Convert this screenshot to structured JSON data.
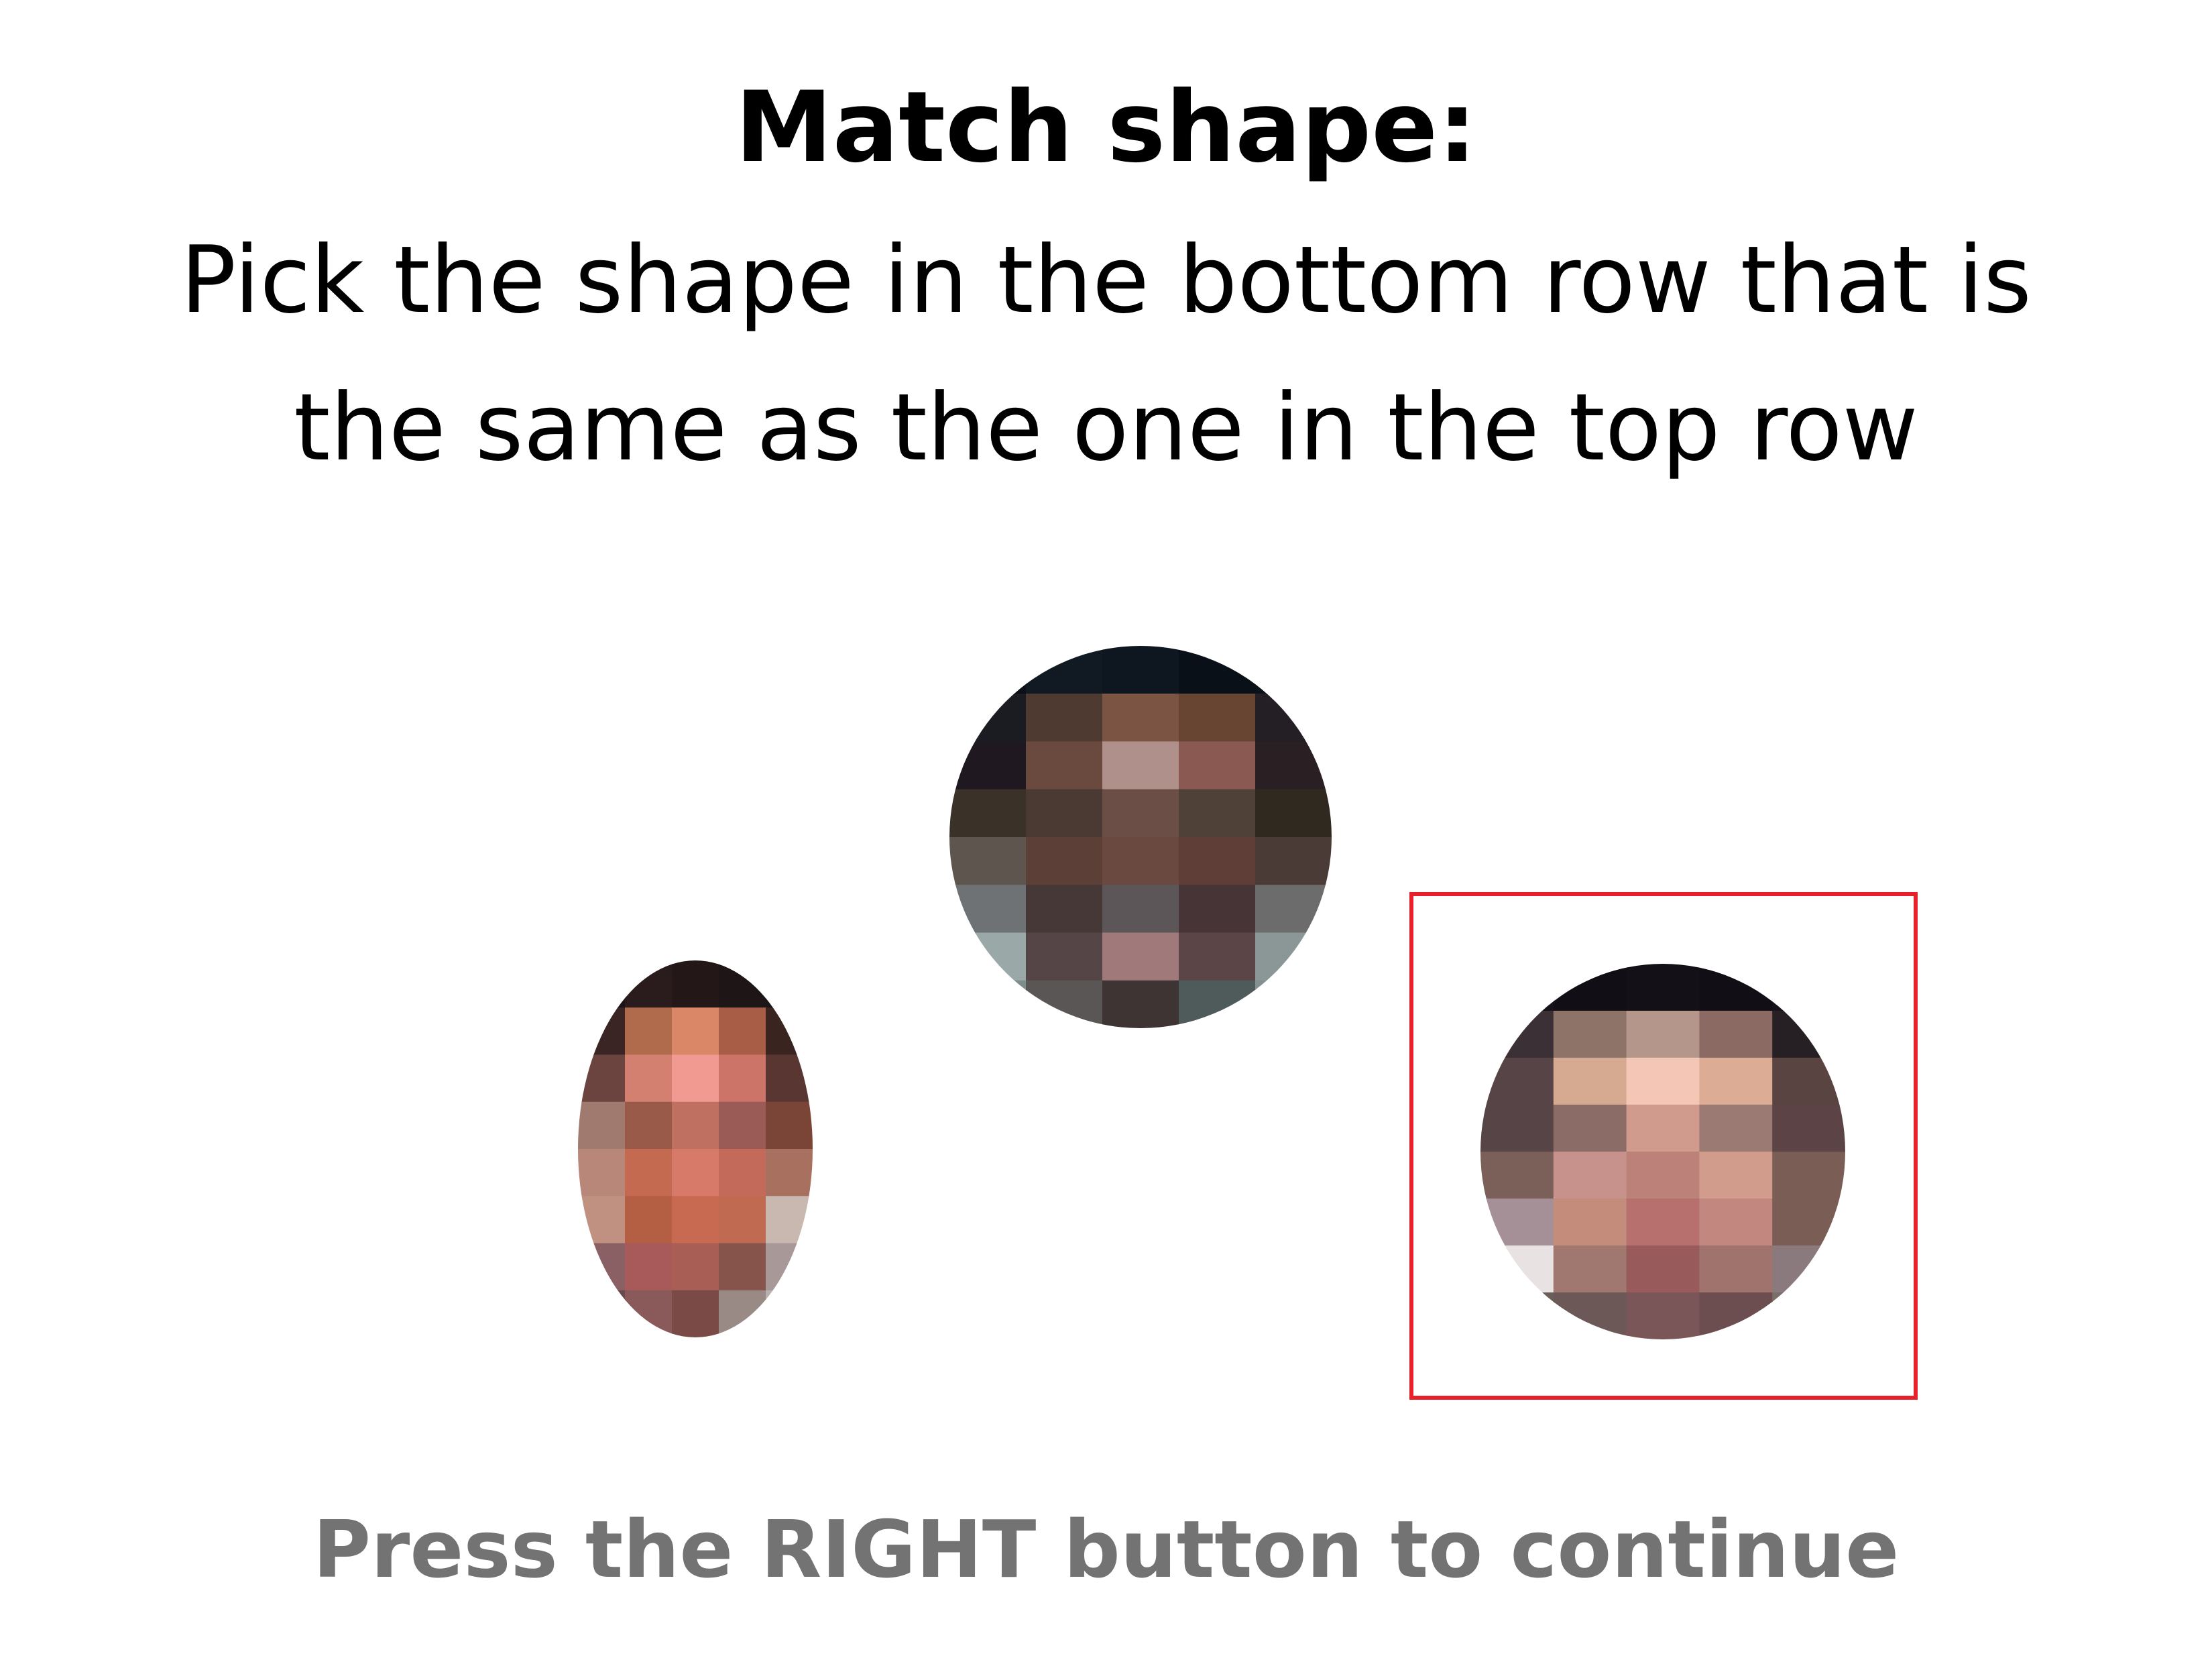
{
  "instructions": {
    "title": "Match shape:",
    "line1": "Pick the shape in the bottom row that is",
    "line2": "the same as the one in the top row"
  },
  "stimuli": {
    "target": {
      "shape": "circle",
      "row": "top",
      "cells": [
        [
          "#0b1018",
          "#111922",
          "#0e1620",
          "#0a1018",
          "#0c121a"
        ],
        [
          "#1b1b22",
          "#4e3a31",
          "#7b5444",
          "#684433",
          "#231f24"
        ],
        [
          "#1f1820",
          "#6a4a3e",
          "#b0908a",
          "#8a5a52",
          "#2a2023"
        ],
        [
          "#3a3129",
          "#4a3a33",
          "#6b4e45",
          "#4f4038",
          "#30291f"
        ],
        [
          "#5d554e",
          "#5c4038",
          "#6a4a40",
          "#5e3e36",
          "#4a3b36"
        ],
        [
          "#6f7274",
          "#463837",
          "#5c5659",
          "#463436",
          "#6c6c6c"
        ],
        [
          "#9ba8a8",
          "#554547",
          "#a07a7a",
          "#5b4547",
          "#8b9797"
        ],
        [
          "#7f8c8c",
          "#5a5656",
          "#3e3434",
          "#4f5a5b",
          "#84908f"
        ]
      ]
    },
    "options": [
      {
        "shape": "ellipse",
        "row": "bottom",
        "selected": false,
        "cells": [
          [
            "#1e1416",
            "#2a1c1c",
            "#231717",
            "#1e1616",
            "#1b1515"
          ],
          [
            "#3b2424",
            "#b06a4c",
            "#d98766",
            "#a85d46",
            "#3a2420"
          ],
          [
            "#6b4440",
            "#d48070",
            "#f09a92",
            "#cc7468",
            "#5a3632"
          ],
          [
            "#a07a6e",
            "#9a5a4a",
            "#c07060",
            "#9a5a55",
            "#7a4436"
          ],
          [
            "#b8877a",
            "#c46a50",
            "#d87a6a",
            "#c46a5a",
            "#a8705e"
          ],
          [
            "#c09080",
            "#b45e44",
            "#c86a52",
            "#c06a52",
            "#c8b8b0"
          ],
          [
            "#8a6064",
            "#a85a5a",
            "#a85e54",
            "#86544a",
            "#a89898"
          ],
          [
            "#6a4a4a",
            "#8a5a5a",
            "#7a4a46",
            "#9a8a86",
            "#b8b0ae"
          ]
        ]
      },
      {
        "shape": "circle",
        "row": "bottom",
        "selected": true,
        "cells": [
          [
            "#16121a",
            "#120e16",
            "#141018",
            "#120e16",
            "#16121a"
          ],
          [
            "#3a3035",
            "#8e7468",
            "#b4968a",
            "#8a6a62",
            "#262024"
          ],
          [
            "#574446",
            "#d6aa90",
            "#f4c6b6",
            "#dcac94",
            "#5a4442"
          ],
          [
            "#574446",
            "#8c6c66",
            "#d09a8c",
            "#9a7a72",
            "#5c4446"
          ],
          [
            "#7a6058",
            "#c8928c",
            "#bc827a",
            "#d29c8c",
            "#7a5e56"
          ],
          [
            "#a49096",
            "#c48c7a",
            "#b8706e",
            "#c28880",
            "#7a5e56"
          ],
          [
            "#e8e2e2",
            "#a07870",
            "#985a5a",
            "#a0746c",
            "#8a7a7e"
          ],
          [
            "#6a5e58",
            "#6c5856",
            "#7a5658",
            "#6c4e50",
            "#7a6e6a"
          ]
        ]
      }
    ]
  },
  "prompt": {
    "continue_text": "Press the RIGHT button to continue"
  },
  "colors": {
    "selection_outline": "#e8202a",
    "footer_text": "#737373"
  }
}
